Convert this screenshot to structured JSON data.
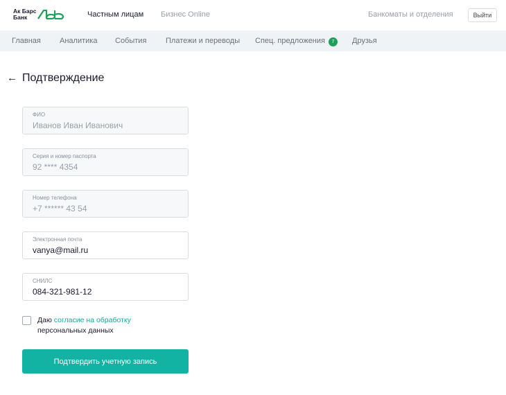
{
  "header": {
    "logo_line1": "Ак Барс",
    "logo_line2": "Банк",
    "links": [
      "Частным лицам",
      "Бизнес Online"
    ],
    "atm_link": "Банкоматы и отделения",
    "logout_label": "Выйти"
  },
  "nav": {
    "items": [
      "Главная",
      "Аналитика",
      "События",
      "Платежи и переводы",
      "Спец. предложения",
      "Друзья"
    ],
    "badge_count": "7"
  },
  "page": {
    "back_icon": "arrow-left-icon",
    "title": "Подтверждение"
  },
  "form": {
    "fields": [
      {
        "label": "ФИО",
        "value": "Иванов Иван Иванович",
        "disabled": true
      },
      {
        "label": "Серия и номер паспорта",
        "value": "92 **** 4354",
        "disabled": true
      },
      {
        "label": "Номер телефона",
        "value": "+7 ****** 43 54",
        "disabled": true
      },
      {
        "label": "Электронная почта",
        "value": "vanya@mail.ru",
        "disabled": false
      },
      {
        "label": "СНИЛС",
        "value": "084-321-981-12",
        "disabled": false
      }
    ],
    "consent_prefix": "Даю ",
    "consent_link": "согласие на обработку",
    "consent_suffix": "персональных данных",
    "consent_checked": false,
    "submit_label": "Подтвердить учетную запись"
  },
  "colors": {
    "accent": "#13b3a4",
    "link": "#13a89e",
    "badge": "#1ea05a",
    "nav_bg": "#f0f3f6"
  }
}
